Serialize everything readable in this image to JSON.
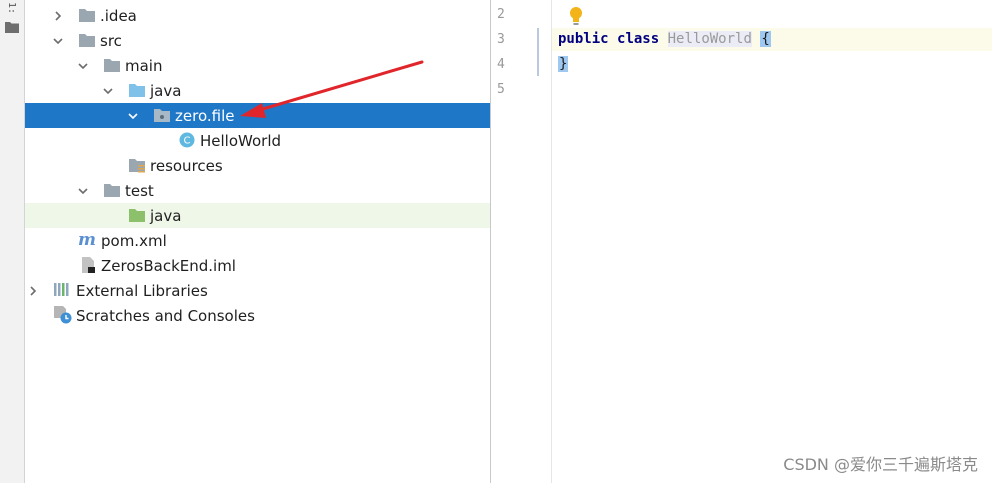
{
  "toolstrip": {
    "tab_label": "1:"
  },
  "tree": {
    "rows": [
      {
        "label": ".idea",
        "expanded": false,
        "icon": "folder-icon",
        "state": "normal"
      },
      {
        "label": "src",
        "expanded": true,
        "icon": "folder-icon",
        "state": "normal"
      },
      {
        "label": "main",
        "expanded": true,
        "icon": "folder-icon",
        "state": "normal"
      },
      {
        "label": "java",
        "expanded": true,
        "icon": "source-folder-icon",
        "state": "normal"
      },
      {
        "label": "zero.file",
        "expanded": true,
        "icon": "package-icon",
        "state": "selected"
      },
      {
        "label": "HelloWorld",
        "icon": "class-icon",
        "icon_glyph": "C",
        "state": "normal"
      },
      {
        "label": "resources",
        "icon": "resources-folder-icon",
        "state": "normal"
      },
      {
        "label": "test",
        "expanded": true,
        "icon": "folder-icon",
        "state": "normal"
      },
      {
        "label": "java",
        "icon": "test-source-folder-icon",
        "state": "highlight"
      },
      {
        "label": "pom.xml",
        "icon": "maven-icon",
        "icon_glyph": "m",
        "state": "normal"
      },
      {
        "label": "ZerosBackEnd.iml",
        "icon": "module-file-icon",
        "state": "normal"
      },
      {
        "label": "External Libraries",
        "expanded": false,
        "icon": "libraries-icon",
        "state": "normal"
      },
      {
        "label": "Scratches and Consoles",
        "icon": "scratches-icon",
        "state": "normal"
      }
    ]
  },
  "editor": {
    "line_numbers": [
      "2",
      "3",
      "4",
      "5"
    ],
    "code": {
      "kw_public": "public",
      "kw_class": "class",
      "class_name": "HelloWorld",
      "open_brace": "{",
      "close_brace": "}"
    }
  },
  "colors": {
    "selection": "#1e78c7",
    "highlight_row": "#eff7e8",
    "arrow": "#e0262b",
    "keyword": "#000080"
  },
  "watermark": "CSDN @爱你三千遍斯塔克"
}
